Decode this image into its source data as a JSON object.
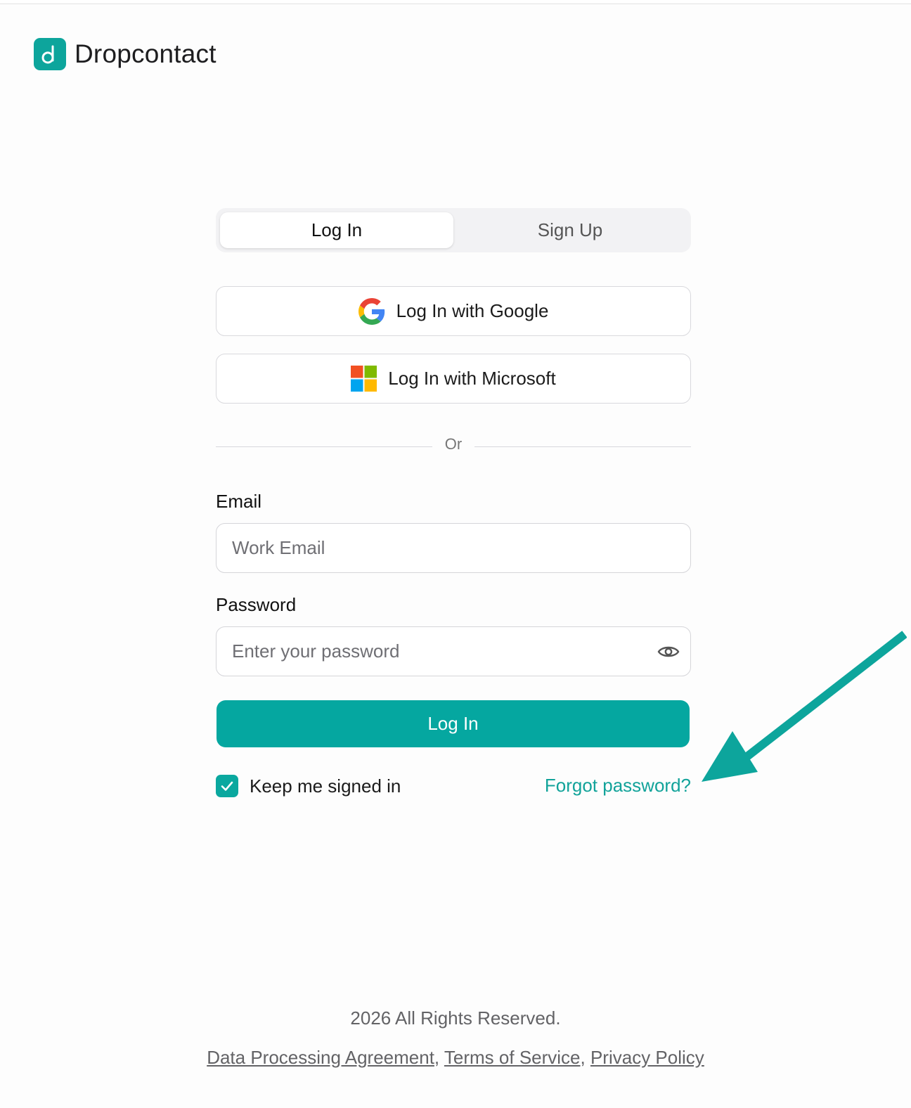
{
  "brand": {
    "name": "Dropcontact",
    "accent": "#05a7a0"
  },
  "tabs": [
    {
      "label": "Log In",
      "active": true
    },
    {
      "label": "Sign Up",
      "active": false
    }
  ],
  "social": {
    "google_label": "Log In with Google",
    "microsoft_label": "Log In with Microsoft"
  },
  "divider": {
    "text": "Or"
  },
  "form": {
    "email_label": "Email",
    "email_placeholder": "Work Email",
    "email_value": "",
    "password_label": "Password",
    "password_placeholder": "Enter your password",
    "password_value": "",
    "submit_label": "Log In",
    "keep_signed_in_label": "Keep me signed in",
    "keep_signed_in_checked": true,
    "forgot_label": "Forgot password?"
  },
  "footer": {
    "copyright": "2026 All Rights Reserved.",
    "links": [
      "Data Processing Agreement",
      "Terms of Service",
      "Privacy Policy"
    ]
  },
  "icons": {
    "logo": "dropcontact-logo-icon",
    "google": "google-icon",
    "microsoft": "microsoft-icon",
    "eye": "eye-icon",
    "check": "checkmark-icon",
    "annotation": "arrow-annotation"
  }
}
